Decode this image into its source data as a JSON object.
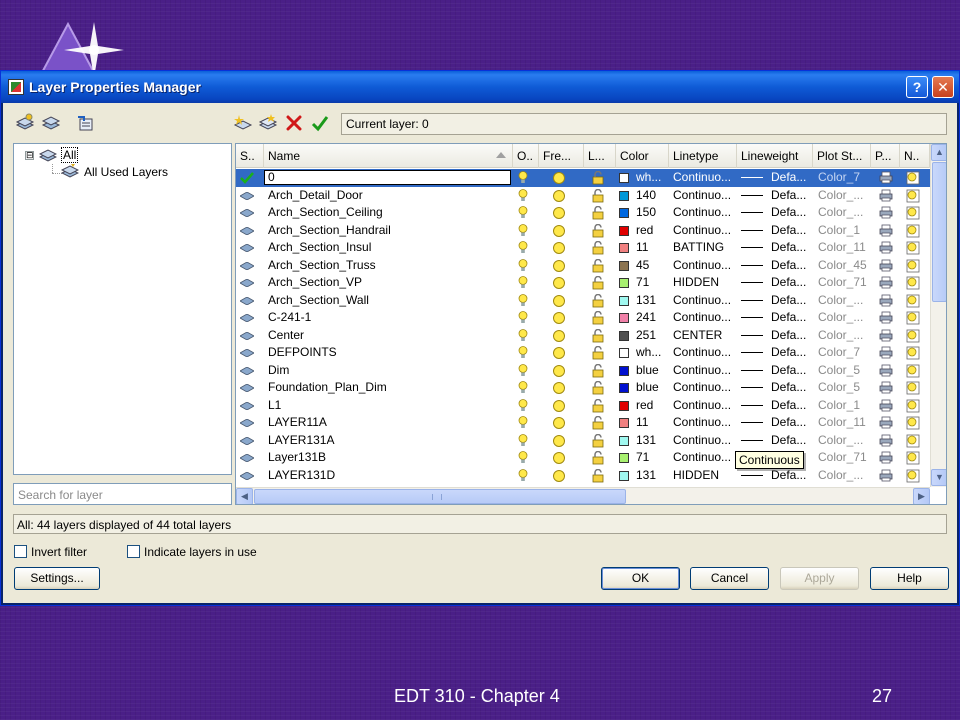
{
  "window": {
    "title": "Layer Properties Manager",
    "help_glyph": "?",
    "close_glyph": "✕"
  },
  "toolbar": {
    "left_icons": [
      "new-property-filter-icon",
      "new-group-filter-icon",
      "layer-states-manager-icon"
    ],
    "right_icons": [
      "new-layer-icon",
      "new-layer-vp-frozen-icon",
      "delete-layer-icon",
      "set-current-icon"
    ],
    "current_layer_label": "Current layer: 0"
  },
  "tree": {
    "expander": "⊟",
    "root_label": "All",
    "child_label": "All Used Layers"
  },
  "search": {
    "placeholder": "Search for layer"
  },
  "columns": [
    "S..",
    "Name",
    "O..",
    "Fre...",
    "L...",
    "Color",
    "Linetype",
    "Lineweight",
    "Plot St...",
    "P...",
    "N.."
  ],
  "layers": [
    {
      "name": "0",
      "color_name": "wh...",
      "color": "#ffffff",
      "linetype": "Continuo...",
      "lineweight": "Defa...",
      "plot_style": "Color_7",
      "current": true
    },
    {
      "name": "Arch_Detail_Door",
      "color_name": "140",
      "color": "#0098d8",
      "linetype": "Continuo...",
      "lineweight": "Defa...",
      "plot_style": "Color_..."
    },
    {
      "name": "Arch_Section_Ceiling",
      "color_name": "150",
      "color": "#0068e0",
      "linetype": "Continuo...",
      "lineweight": "Defa...",
      "plot_style": "Color_..."
    },
    {
      "name": "Arch_Section_Handrail",
      "color_name": "red",
      "color": "#e00000",
      "linetype": "Continuo...",
      "lineweight": "Defa...",
      "plot_style": "Color_1"
    },
    {
      "name": "Arch_Section_Insul",
      "color_name": "11",
      "color": "#f08080",
      "linetype": "BATTING",
      "lineweight": "Defa...",
      "plot_style": "Color_11"
    },
    {
      "name": "Arch_Section_Truss",
      "color_name": "45",
      "color": "#8c7450",
      "linetype": "Continuo...",
      "lineweight": "Defa...",
      "plot_style": "Color_45"
    },
    {
      "name": "Arch_Section_VP",
      "color_name": "71",
      "color": "#a8f070",
      "linetype": "HIDDEN",
      "lineweight": "Defa...",
      "plot_style": "Color_71"
    },
    {
      "name": "Arch_Section_Wall",
      "color_name": "131",
      "color": "#a0f8f0",
      "linetype": "Continuo...",
      "lineweight": "Defa...",
      "plot_style": "Color_..."
    },
    {
      "name": "C-241-1",
      "color_name": "241",
      "color": "#f080a8",
      "linetype": "Continuo...",
      "lineweight": "Defa...",
      "plot_style": "Color_..."
    },
    {
      "name": "Center",
      "color_name": "251",
      "color": "#505050",
      "linetype": "CENTER",
      "lineweight": "Defa...",
      "plot_style": "Color_..."
    },
    {
      "name": "DEFPOINTS",
      "color_name": "wh...",
      "color": "#ffffff",
      "linetype": "Continuo...",
      "lineweight": "Defa...",
      "plot_style": "Color_7"
    },
    {
      "name": "Dim",
      "color_name": "blue",
      "color": "#0010d0",
      "linetype": "Continuo...",
      "lineweight": "Defa...",
      "plot_style": "Color_5"
    },
    {
      "name": "Foundation_Plan_Dim",
      "color_name": "blue",
      "color": "#0010d0",
      "linetype": "Continuo...",
      "lineweight": "Defa...",
      "plot_style": "Color_5"
    },
    {
      "name": "L1",
      "color_name": "red",
      "color": "#e00000",
      "linetype": "Continuo...",
      "lineweight": "Defa...",
      "plot_style": "Color_1"
    },
    {
      "name": "LAYER11A",
      "color_name": "11",
      "color": "#f08080",
      "linetype": "Continuo...",
      "lineweight": "Defa...",
      "plot_style": "Color_11"
    },
    {
      "name": "LAYER131A",
      "color_name": "131",
      "color": "#a0f8f0",
      "linetype": "Continuo...",
      "lineweight": "Defa...",
      "plot_style": "Color_..."
    },
    {
      "name": "Layer131B",
      "color_name": "71",
      "color": "#a8f070",
      "linetype": "Continuo...",
      "lineweight": "",
      "plot_style": "Color_71"
    },
    {
      "name": "LAYER131D",
      "color_name": "131",
      "color": "#a0f8f0",
      "linetype": "HIDDEN",
      "lineweight": "Defa...",
      "plot_style": "Color_..."
    }
  ],
  "tooltip": "Continuous",
  "status_text": "All: 44 layers displayed of 44 total layers",
  "checkboxes": {
    "invert_filter": "Invert filter",
    "indicate_layers": "Indicate layers in use"
  },
  "buttons": {
    "settings": "Settings...",
    "ok": "OK",
    "cancel": "Cancel",
    "apply": "Apply",
    "help": "Help"
  },
  "slide": {
    "footer_title": "EDT 310 - Chapter 4",
    "page_number": "27"
  }
}
